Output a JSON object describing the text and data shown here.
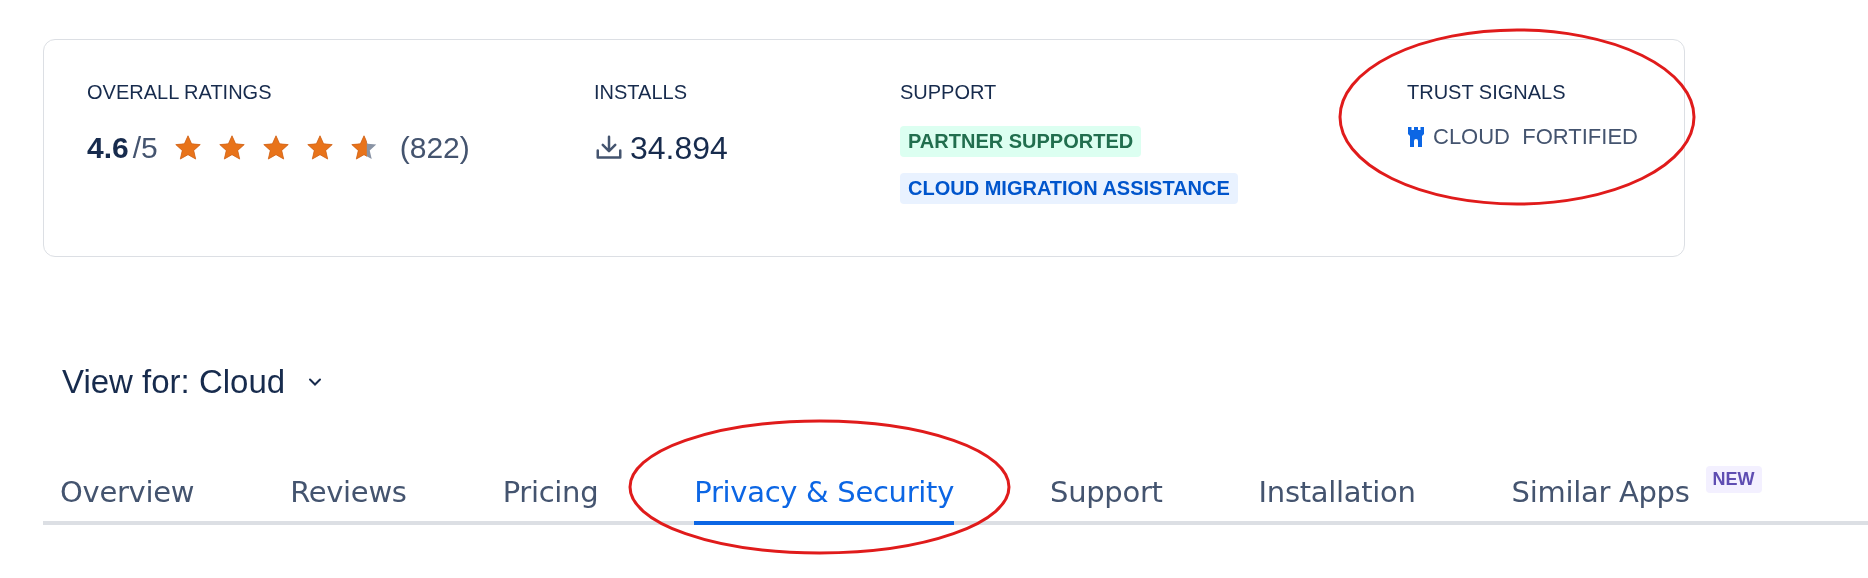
{
  "stats": {
    "ratings": {
      "label": "OVERALL RATINGS",
      "score": "4.6",
      "out_of": "/5",
      "stars": 4.6,
      "count": "(822)"
    },
    "installs": {
      "label": "INSTALLS",
      "value": "34.894"
    },
    "support": {
      "label": "SUPPORT",
      "tags": [
        {
          "text": "PARTNER SUPPORTED",
          "kind": "green"
        },
        {
          "text": "CLOUD MIGRATION ASSISTANCE",
          "kind": "blue"
        }
      ]
    },
    "trust_signals": {
      "label": "TRUST SIGNALS",
      "value": "CLOUD  FORTIFIED",
      "highlighted": true
    }
  },
  "view_for": {
    "label": "View for: Cloud"
  },
  "tabs": [
    {
      "label": "Overview",
      "selected": false,
      "highlighted": false
    },
    {
      "label": "Reviews",
      "selected": false,
      "highlighted": false
    },
    {
      "label": "Pricing",
      "selected": false,
      "highlighted": false
    },
    {
      "label": "Privacy & Security",
      "selected": true,
      "highlighted": true
    },
    {
      "label": "Support",
      "selected": false,
      "highlighted": false
    },
    {
      "label": "Installation",
      "selected": false,
      "highlighted": false
    },
    {
      "label": "Similar Apps",
      "selected": false,
      "highlighted": false,
      "badge": "NEW"
    }
  ]
}
